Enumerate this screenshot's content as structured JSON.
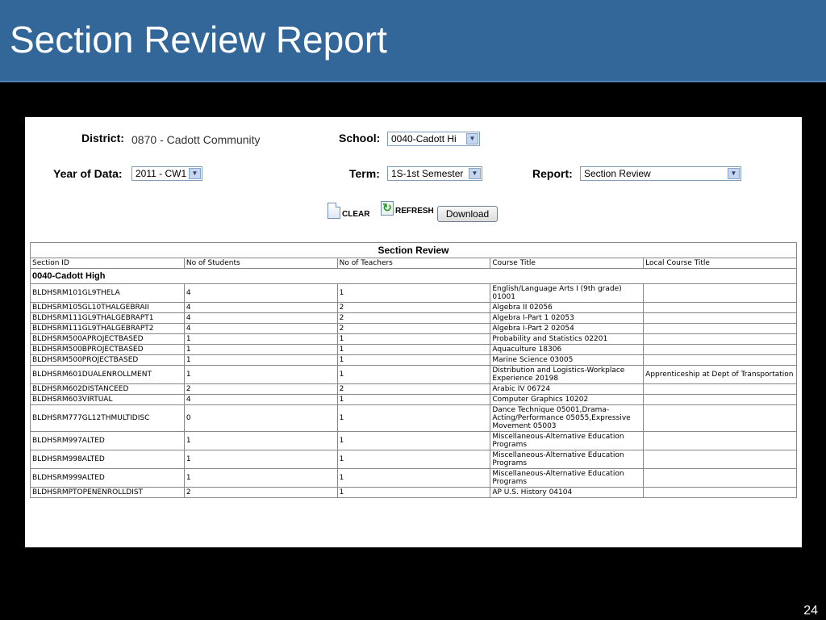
{
  "slide": {
    "title": "Section Review Report",
    "page_number": "24"
  },
  "filters": {
    "district_label": "District:",
    "district_value": "0870 - Cadott Community",
    "school_label": "School:",
    "school_value": "0040-Cadott Hi",
    "year_label": "Year of Data:",
    "year_value": "2011 - CW1",
    "term_label": "Term:",
    "term_value": "1S-1st Semester",
    "report_label": "Report:",
    "report_value": "Section Review"
  },
  "actions": {
    "clear_label": "CLEAR",
    "refresh_label": "REFRESH",
    "download_label": "Download"
  },
  "report": {
    "caption": "Section Review",
    "columns": [
      "Section ID",
      "No of Students",
      "No of Teachers",
      "Course Title",
      "Local Course Title"
    ],
    "school": "0040-Cadott High",
    "rows": [
      [
        "BLDHSRM101GL9THELA",
        "4",
        "1",
        "English/Language Arts I (9th grade) 01001",
        ""
      ],
      [
        "BLDHSRM105GL10THALGEBRAII",
        "4",
        "2",
        "Algebra II 02056",
        ""
      ],
      [
        "BLDHSRM111GL9THALGEBRAPT1",
        "4",
        "2",
        "Algebra I-Part 1 02053",
        ""
      ],
      [
        "BLDHSRM111GL9THALGEBRAPT2",
        "4",
        "2",
        "Algebra I-Part 2 02054",
        ""
      ],
      [
        "BLDHSRM500APROJECTBASED",
        "1",
        "1",
        "Probability and Statistics 02201",
        ""
      ],
      [
        "BLDHSRM500BPROJECTBASED",
        "1",
        "1",
        "Aquaculture 18306",
        ""
      ],
      [
        "BLDHSRM500PROJECTBASED",
        "1",
        "1",
        "Marine Science 03005",
        ""
      ],
      [
        "BLDHSRM601DUALENROLLMENT",
        "1",
        "1",
        "Distribution and Logistics-Workplace Experience 20198",
        "Apprenticeship at Dept of Transportation"
      ],
      [
        "BLDHSRM602DISTANCEED",
        "2",
        "2",
        "Arabic IV 06724",
        ""
      ],
      [
        "BLDHSRM603VIRTUAL",
        "4",
        "1",
        "Computer Graphics 10202",
        ""
      ],
      [
        "BLDHSRM777GL12THMULTIDISC",
        "0",
        "1",
        "Dance Technique 05001,Drama-Acting/Performance 05055,Expressive Movement 05003",
        ""
      ],
      [
        "BLDHSRM997ALTED",
        "1",
        "1",
        "Miscellaneous-Alternative Education Programs",
        ""
      ],
      [
        "BLDHSRM998ALTED",
        "1",
        "1",
        "Miscellaneous-Alternative Education Programs",
        ""
      ],
      [
        "BLDHSRM999ALTED",
        "1",
        "1",
        "Miscellaneous-Alternative Education Programs",
        ""
      ],
      [
        "BLDHSRMPTOPENENROLLDIST",
        "2",
        "1",
        "AP U.S. History 04104",
        ""
      ]
    ]
  }
}
